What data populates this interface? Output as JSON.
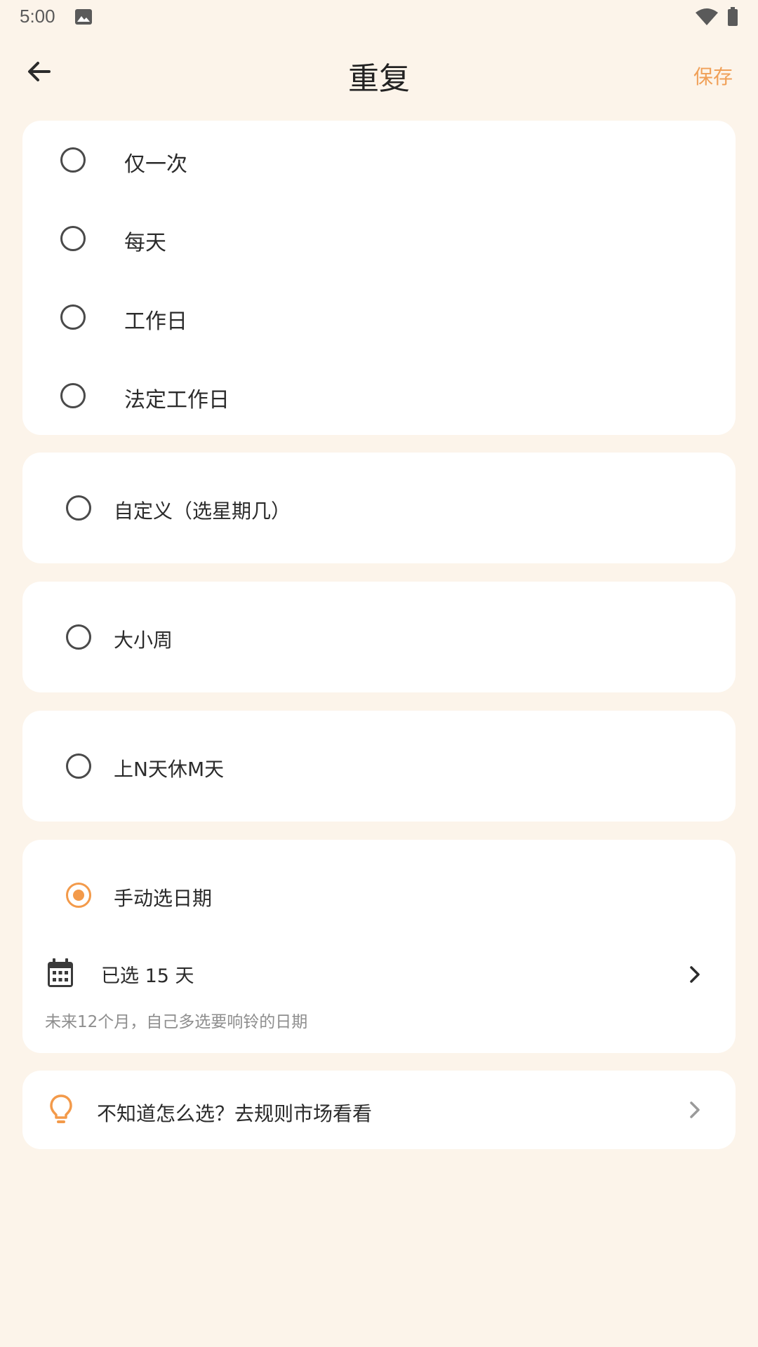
{
  "status_bar": {
    "time": "5:00",
    "icons": [
      "image-icon",
      "wifi-icon",
      "battery-icon"
    ]
  },
  "header": {
    "title": "重复",
    "save_label": "保存",
    "back_icon": "arrow-left-icon"
  },
  "basic_options": [
    {
      "label": "仅一次",
      "selected": false
    },
    {
      "label": "每天",
      "selected": false
    },
    {
      "label": "工作日",
      "selected": false
    },
    {
      "label": "法定工作日",
      "selected": false
    }
  ],
  "custom_option": {
    "label": "自定义（选星期几）",
    "selected": false
  },
  "alternate_weeks_option": {
    "label": "大小周",
    "selected": false
  },
  "shift_option": {
    "label": "上N天休M天",
    "selected": false
  },
  "manual_option": {
    "label": "手动选日期",
    "selected": true,
    "selected_days_label": "已选 15 天",
    "hint": "未来12个月，自己多选要响铃的日期",
    "calendar_icon": "calendar-icon"
  },
  "rule_market": {
    "label": "不知道怎么选？去规则市场看看",
    "icon": "lightbulb-icon"
  },
  "colors": {
    "background": "#FCF4EA",
    "card": "#FFFFFF",
    "accent": "#F39A4A",
    "save_text": "#F0A058",
    "hint_text": "#8E8E8E"
  }
}
